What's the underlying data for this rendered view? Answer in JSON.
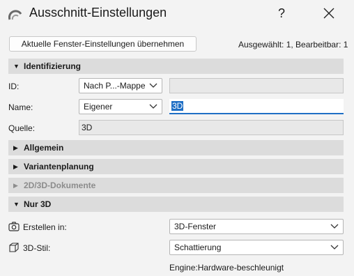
{
  "window": {
    "title": "Ausschnitt-Einstellungen",
    "help": "?"
  },
  "toolbar": {
    "apply_button": "Aktuelle Fenster-Einstellungen übernehmen",
    "selection_info": "Ausgewählt: 1, Bearbeitbar: 1"
  },
  "sections": {
    "identification": "Identifizierung",
    "general": "Allgemein",
    "variants": "Variantenplanung",
    "documents": "2D/3D-Dokumente",
    "only3d": "Nur 3D"
  },
  "identification": {
    "id_label": "ID:",
    "id_select": "Nach P...-Mappe",
    "id_value": "",
    "name_label": "Name:",
    "name_select": "Eigener",
    "name_value": "3D",
    "source_label": "Quelle:",
    "source_value": "3D"
  },
  "only3d": {
    "create_label": "Erstellen in:",
    "create_value": "3D-Fenster",
    "style_label": "3D-Stil:",
    "style_value": "Schattierung",
    "engine": "Engine:Hardware-beschleunigt"
  },
  "colors": {
    "accent": "#1f6fc5",
    "section_bg": "#dcdcdc",
    "window_bg": "#f3f3f3"
  }
}
